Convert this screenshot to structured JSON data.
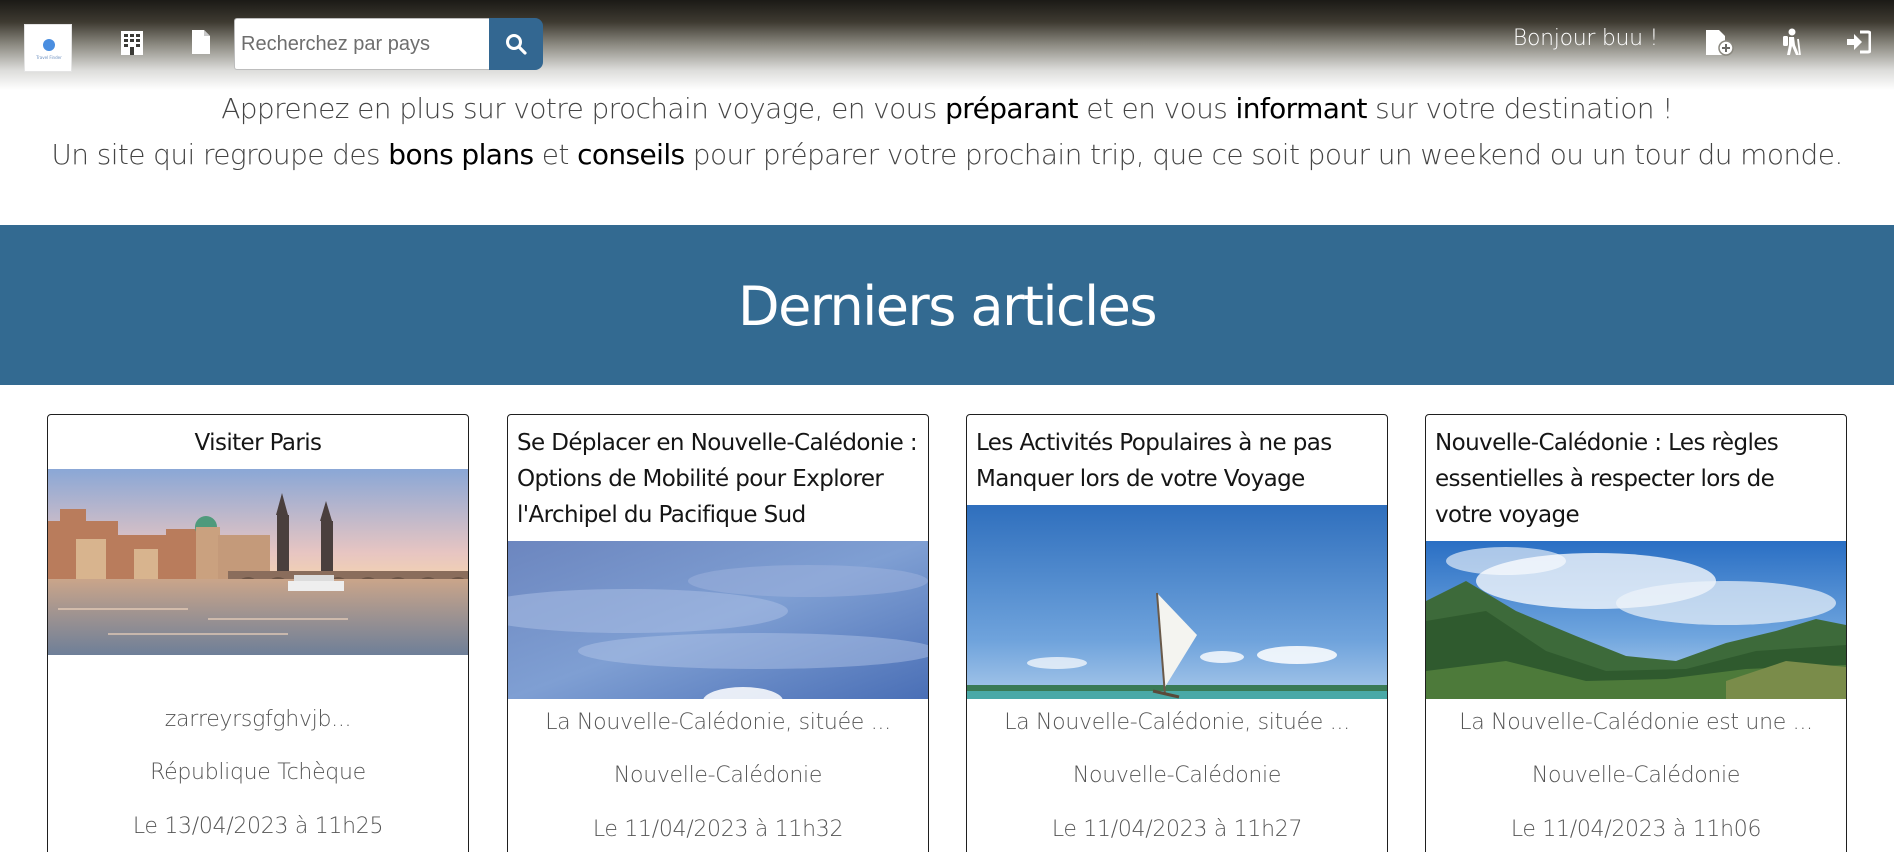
{
  "header": {
    "logo_text": "Travel Finder",
    "search": {
      "placeholder": "Recherchez par pays",
      "value": ""
    },
    "greeting": "Bonjour buu !",
    "icons": [
      "building-icon",
      "document-icon",
      "search-icon",
      "new-file-icon",
      "hiker-icon",
      "sign-in-icon"
    ]
  },
  "intro": {
    "line1": {
      "part1": "Apprenez en plus sur votre prochain voyage, en vous ",
      "bold1": "préparant",
      "part2": " et en vous ",
      "bold2": "informant",
      "part3": " sur votre destination !"
    },
    "line2": {
      "part1": "Un site qui regroupe des ",
      "bold1": "bons plans",
      "part2": " et ",
      "bold2": "conseils",
      "part3": " pour préparer votre prochain trip, que ce soit pour un weekend ou un tour du monde."
    }
  },
  "banner": {
    "title": "Derniers articles"
  },
  "articles": [
    {
      "title": "Visiter Paris",
      "excerpt": "zarreyrsgfghvjb...",
      "country": "République Tchèque",
      "date": "Le 13/04/2023 à 11h25"
    },
    {
      "title": "Se Déplacer en Nouvelle-Calédonie : Options de Mobilité pour Explorer l'Archipel du Pacifique Sud",
      "excerpt": "La Nouvelle-Calédonie, située ...",
      "country": "Nouvelle-Calédonie",
      "date": "Le 11/04/2023 à 11h32"
    },
    {
      "title": "Les Activités Populaires à ne pas Manquer lors de votre Voyage",
      "excerpt": "La Nouvelle-Calédonie, située ...",
      "country": "Nouvelle-Calédonie",
      "date": "Le 11/04/2023 à 11h27"
    },
    {
      "title": "Nouvelle-Calédonie : Les règles essentielles à respecter lors de votre voyage",
      "excerpt": "La Nouvelle-Calédonie est une ...",
      "country": "Nouvelle-Calédonie",
      "date": "Le 11/04/2023 à 11h06"
    }
  ],
  "colors": {
    "accent": "#336a91",
    "search_button": "#336791",
    "text_muted": "#555555"
  }
}
